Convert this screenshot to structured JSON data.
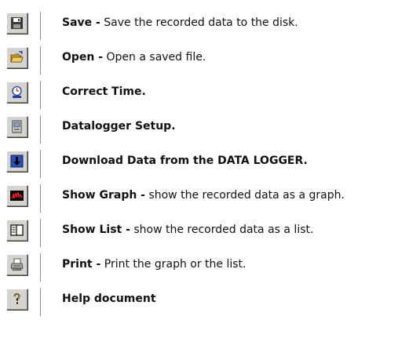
{
  "legend": {
    "items": [
      {
        "icon": "floppy-disk-icon",
        "title": "Save -",
        "text": " Save the recorded data to the disk."
      },
      {
        "icon": "open-folder-icon",
        "title": "Open -",
        "text": " Open a saved file."
      },
      {
        "icon": "clock-icon",
        "title": "Correct Time.",
        "text": ""
      },
      {
        "icon": "datalogger-setup-icon",
        "title": "Datalogger Setup.",
        "text": ""
      },
      {
        "icon": "download-arrow-icon",
        "title": "Download Data from the DATA LOGGER.",
        "text": ""
      },
      {
        "icon": "graph-icon",
        "title": "Show Graph -",
        "text": " show the recorded data as a graph."
      },
      {
        "icon": "list-icon",
        "title": "Show List -",
        "text": " show the recorded data as a list."
      },
      {
        "icon": "printer-icon",
        "title": "Print -",
        "text": " Print the graph or the list."
      },
      {
        "icon": "help-icon",
        "title": "Help document",
        "text": ""
      }
    ]
  },
  "colors": {
    "button_face": "#d6d3ce",
    "icon_blue": "#1f3f9f",
    "icon_red": "#cc1010"
  }
}
